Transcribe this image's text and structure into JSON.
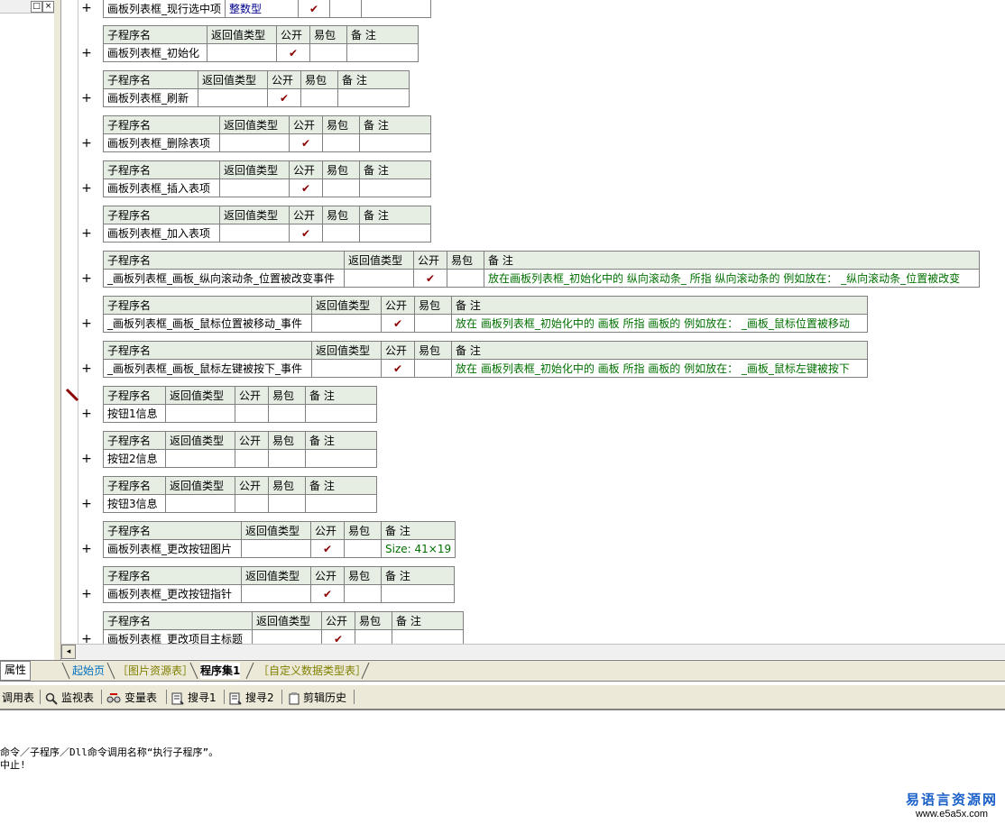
{
  "left_panel": {
    "title_buttons": [
      "□",
      "×"
    ],
    "tab_label": "属性"
  },
  "headers": {
    "name": "子程序名",
    "return_type": "返回值类型",
    "public": "公开",
    "easy_pack": "易包",
    "note": "备 注"
  },
  "check_mark": "✔",
  "top_partial_row": {
    "name": "画板列表框_现行选中项",
    "return_type": "整数型",
    "public": true
  },
  "subroutines": [
    {
      "name": "画板列表框_初始化",
      "return_type": "",
      "public": true,
      "note": ""
    },
    {
      "name": "画板列表框_刷新",
      "return_type": "",
      "public": true,
      "note": ""
    },
    {
      "name": "画板列表框_删除表项",
      "return_type": "",
      "public": true,
      "note": ""
    },
    {
      "name": "画板列表框_插入表项",
      "return_type": "",
      "public": true,
      "note": ""
    },
    {
      "name": "画板列表框_加入表项",
      "return_type": "",
      "public": true,
      "note": ""
    },
    {
      "name": "_画板列表框_画板_纵向滚动条_位置被改变事件",
      "return_type": "",
      "public": true,
      "note": "放在画板列表框_初始化中的 纵向滚动条_ 所指 纵向滚动条的 例如放在： _纵向滚动条_位置被改变"
    },
    {
      "name": "_画板列表框_画板_鼠标位置被移动_事件",
      "return_type": "",
      "public": true,
      "note": "放在 画板列表框_初始化中的 画板 所指 画板的 例如放在： _画板_鼠标位置被移动"
    },
    {
      "name": "_画板列表框_画板_鼠标左键被按下_事件",
      "return_type": "",
      "public": true,
      "note": "放在 画板列表框_初始化中的 画板 所指 画板的 例如放在： _画板_鼠标左键被按下"
    },
    {
      "name": "按钮1信息",
      "return_type": "",
      "public": false,
      "note": ""
    },
    {
      "name": "按钮2信息",
      "return_type": "",
      "public": false,
      "note": ""
    },
    {
      "name": "按钮3信息",
      "return_type": "",
      "public": false,
      "note": ""
    },
    {
      "name": "画板列表框_更改按钮图片",
      "return_type": "",
      "public": true,
      "note": "Size: 41×19"
    },
    {
      "name": "画板列表框_更改按钮指针",
      "return_type": "",
      "public": true,
      "note": ""
    },
    {
      "name": "画板列表框_更改项目主标题",
      "return_type": "",
      "public": true,
      "note": ""
    }
  ],
  "tabs": {
    "start": "起始页",
    "images": "［图片资源表］",
    "program_set": "程序集1",
    "custom_types": "［自定义数据类型表］"
  },
  "toolbar": {
    "call_table": "调用表",
    "monitor": "监视表",
    "variables": "变量表",
    "search1": "搜寻1",
    "search2": "搜寻2",
    "clip_history": "剪辑历史"
  },
  "output": {
    "line1": "命令／子程序／Dll命令调用名称“执行子程序”。",
    "line2": "中止!"
  },
  "watermark": {
    "title": "易语言资源网",
    "url": "www.e5a5x.com"
  }
}
